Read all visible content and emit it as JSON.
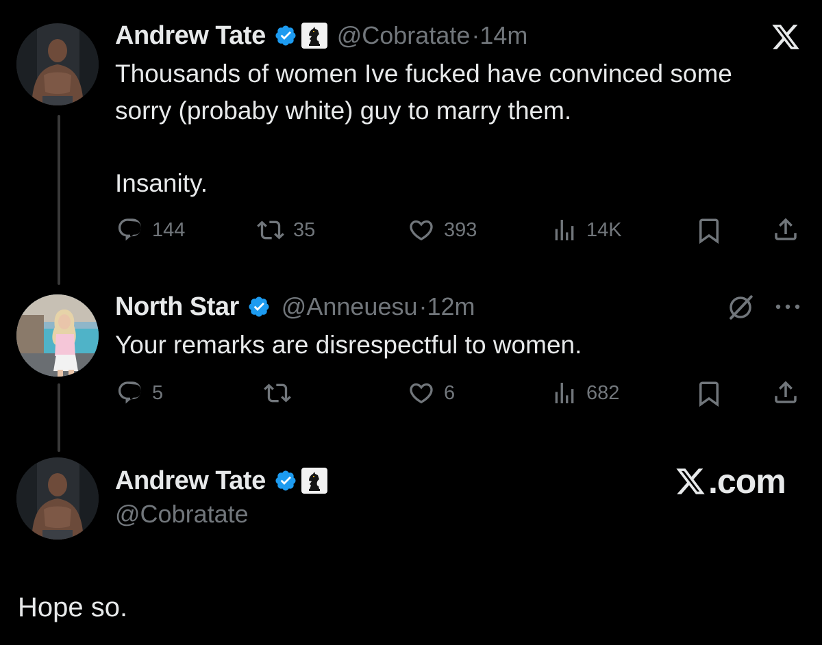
{
  "tweet1": {
    "name": "Andrew Tate",
    "handle": "@Cobratate",
    "time": "·14m",
    "line1": "Thousands of women Ive fucked have convinced some",
    "line2": "sorry (probaby white) guy to marry them.",
    "line3": "Insanity.",
    "stats": {
      "replies": "144",
      "reposts": "35",
      "likes": "393",
      "views": "14K"
    }
  },
  "tweet2": {
    "name": "North Star",
    "handle": "@Anneuesu",
    "time": "·12m",
    "text": "Your remarks are disrespectful to women.",
    "stats": {
      "replies": "5",
      "reposts": "",
      "likes": "6",
      "views": "682"
    }
  },
  "tweet3": {
    "name": "Andrew Tate",
    "handle": "@Cobratate",
    "brand": "X.com",
    "text": "Hope so."
  },
  "icons": {
    "x_logo": "x-logo-icon",
    "verified": "verified-badge-icon",
    "chess_knight": "chess-knight-icon",
    "more": "more-icon",
    "grok": "grok-icon"
  },
  "colors": {
    "background": "#000000",
    "text": "#e7e9ea",
    "secondary": "#71767b",
    "verified": "#1d9bf0"
  }
}
